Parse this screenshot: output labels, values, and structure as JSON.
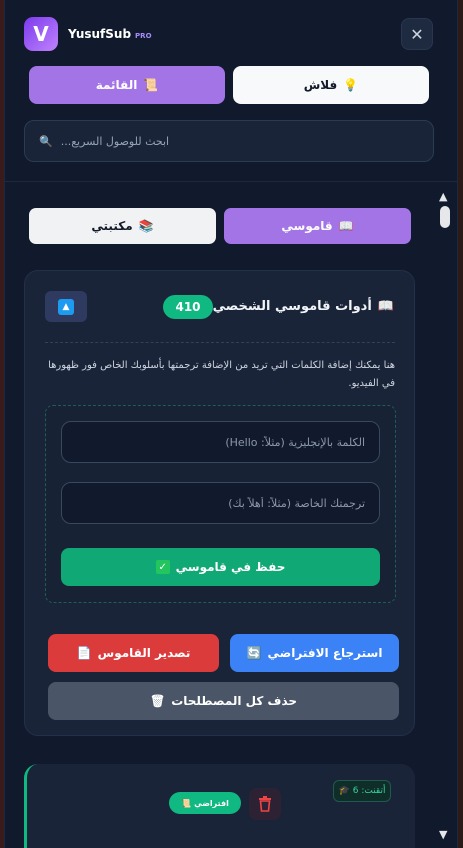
{
  "header": {
    "brand_name": "YusufSub",
    "brand_tag": "PRO",
    "logo_letter": "V",
    "close_icon": "✕"
  },
  "nav": {
    "list_label": "القائمة",
    "list_icon": "📜",
    "flash_label": "فلاش",
    "flash_icon": "💡"
  },
  "search": {
    "placeholder": "ابحث للوصول السريع...",
    "icon": "🔍"
  },
  "tabs": {
    "dictionary_label": "قاموسي",
    "dictionary_icon": "📖",
    "library_label": "مكتبتي",
    "library_icon": "📚"
  },
  "dictionary_tools": {
    "title": "أدوات قاموسي الشخصي",
    "title_icon": "📖",
    "count": "410",
    "collapse_icon": "▲",
    "description": "هنا يمكنك إضافة الكلمات التي تريد من الإضافة ترجمتها بأسلوبك الخاص فور ظهورها في الفيديو.",
    "english_placeholder": "الكلمة بالإنجليزية (مثلاً: Hello)",
    "translation_placeholder": "ترجمتك الخاصة (مثلاً: أهلاً بك)",
    "save_label": "حفظ في قاموسي",
    "save_icon": "✓",
    "restore_label": "استرجاع الافتراضي",
    "restore_icon": "🔄",
    "export_label": "تصدير القاموس",
    "export_icon": "📄",
    "delete_all_label": "حذف كل المصطلحات",
    "delete_all_icon": "🗑"
  },
  "entry": {
    "learned_label": "أتقنت: 6",
    "learned_icon": "🎓",
    "default_label": "افتراضي",
    "default_icon": "📜"
  },
  "colors": {
    "accent_purple": "#a374e6",
    "accent_green": "#10b981",
    "accent_blue": "#3b82f6",
    "accent_red": "#dc3b3b"
  }
}
